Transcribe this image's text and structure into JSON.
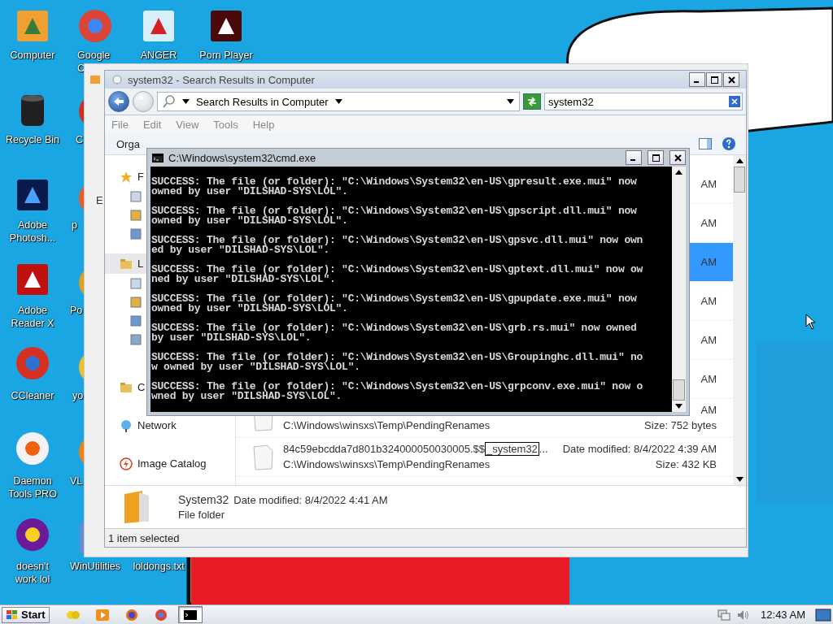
{
  "desktop_icons": [
    {
      "lines": [
        "Computer"
      ]
    },
    {
      "lines": [
        "Google",
        "C"
      ]
    },
    {
      "lines": [
        "ANGER"
      ]
    },
    {
      "lines": [
        "Porn Player"
      ]
    },
    {
      "lines": [
        "Recycle Bin"
      ]
    },
    {
      "lines": [
        "C"
      ]
    },
    {
      "lines": [
        "Adobe",
        "Photosh..."
      ]
    },
    {
      "lines": [
        "p"
      ]
    },
    {
      "lines": [
        "Adobe",
        "Reader X"
      ]
    },
    {
      "lines": [
        "Po"
      ]
    },
    {
      "lines": [
        "CCleaner"
      ]
    },
    {
      "lines": [
        "yo"
      ]
    },
    {
      "lines": [
        "Daemon",
        "Tools PRO"
      ]
    },
    {
      "lines": [
        "VL"
      ]
    },
    {
      "lines": [
        "doesn't",
        "work lol"
      ]
    },
    {
      "lines": [
        "WinUtilities"
      ]
    },
    {
      "lines": [
        "loldongs.txt"
      ]
    }
  ],
  "back_window": {
    "text": "E"
  },
  "explorer": {
    "title": "system32 - Search Results in Computer",
    "address": "Search Results in Computer",
    "search": {
      "value": "system32"
    },
    "menu": [
      "File",
      "Edit",
      "View",
      "Tools",
      "Help"
    ],
    "organize": "Orga",
    "nav": [
      {
        "label": "F",
        "selected": false
      },
      {
        "label": "L",
        "selected": true
      },
      {
        "label": "C",
        "selected": false
      },
      {
        "label": "Network",
        "selected": false
      },
      {
        "label": "Image Catalog",
        "selected": false
      }
    ],
    "results": [
      {
        "date": "AM",
        "selected": false
      },
      {
        "date": "AM",
        "selected": false
      },
      {
        "date": "AM",
        "selected": true
      },
      {
        "date": "AM",
        "selected": false
      },
      {
        "date": "AM",
        "selected": false
      },
      {
        "date": "AM",
        "selected": false
      },
      {
        "date": "AM",
        "path": "C:\\Windows\\winsxs\\Temp\\PendingRenames",
        "size": "Size: 752 bytes",
        "selected": false
      },
      {
        "name": "84c59ebcdda7d801b324000050030005.$$",
        "match": "_system32",
        "name_end": "...",
        "date": "Date modified: 8/4/2022 4:39 AM",
        "path": "C:\\Windows\\winsxs\\Temp\\PendingRenames",
        "size": "Size: 432 KB",
        "selected": false
      }
    ],
    "details": {
      "name": "System32",
      "date": "Date modified: 8/4/2022 4:41 AM",
      "type": "File folder"
    },
    "status": "1 item selected"
  },
  "cmd": {
    "title": "C:\\Windows\\system32\\cmd.exe",
    "entries": [
      {
        "lines": [
          "SUCCESS: The file (or folder): \"C:\\Windows\\System32\\en-US\\gpresult.exe.mui\" now",
          "owned by user \"DILSHAD-SYS\\LOL\"."
        ]
      },
      {
        "lines": [
          "SUCCESS: The file (or folder): \"C:\\Windows\\System32\\en-US\\gpscript.dll.mui\" now",
          "owned by user \"DILSHAD-SYS\\LOL\"."
        ]
      },
      {
        "lines": [
          "SUCCESS: The file (or folder): \"C:\\Windows\\System32\\en-US\\gpsvc.dll.mui\" now own",
          "ed by user \"DILSHAD-SYS\\LOL\"."
        ]
      },
      {
        "lines": [
          "SUCCESS: The file (or folder): \"C:\\Windows\\System32\\en-US\\gptext.dll.mui\" now ow",
          "ned by user \"DILSHAD-SYS\\LOL\"."
        ]
      },
      {
        "lines": [
          "SUCCESS: The file (or folder): \"C:\\Windows\\System32\\en-US\\gpupdate.exe.mui\" now",
          "owned by user \"DILSHAD-SYS\\LOL\"."
        ]
      },
      {
        "lines": [
          "SUCCESS: The file (or folder): \"C:\\Windows\\System32\\en-US\\grb.rs.mui\" now owned",
          "by user \"DILSHAD-SYS\\LOL\"."
        ]
      },
      {
        "lines": [
          "SUCCESS: The file (or folder): \"C:\\Windows\\System32\\en-US\\Groupinghc.dll.mui\" no",
          "w owned by user \"DILSHAD-SYS\\LOL\"."
        ]
      },
      {
        "lines": [
          "SUCCESS: The file (or folder): \"C:\\Windows\\System32\\en-US\\grpconv.exe.mui\" now o",
          "wned by user \"DILSHAD-SYS\\LOL\"."
        ]
      }
    ]
  },
  "taskbar": {
    "start": "Start",
    "apps": [
      {
        "selected": false
      },
      {
        "selected": false
      },
      {
        "selected": false
      },
      {
        "selected": false
      },
      {
        "selected": true
      }
    ],
    "clock": "12:43 AM"
  }
}
